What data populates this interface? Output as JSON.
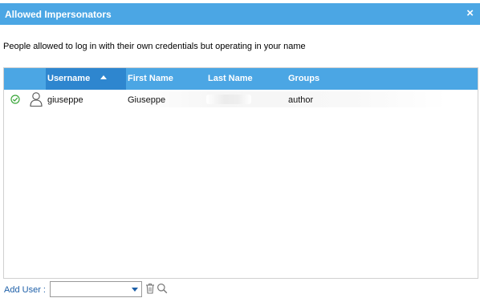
{
  "dialog": {
    "title": "Allowed Impersonators",
    "close_symbol": "×",
    "description": "People allowed to log in with their own credentials but operating in your name"
  },
  "grid": {
    "columns": [
      {
        "label": "Username",
        "sorted": "ascending"
      },
      {
        "label": "First Name"
      },
      {
        "label": "Last Name"
      },
      {
        "label": "Groups"
      }
    ],
    "rows": [
      {
        "status_icon": "check-circle-icon",
        "type_icon": "user-icon",
        "username": "giuseppe",
        "first_name": "Giuseppe",
        "last_name": "",
        "groups": "author"
      }
    ]
  },
  "footer": {
    "add_user_label": "Add User :",
    "add_user_value": "",
    "icons": [
      "trash-icon",
      "search-icon"
    ]
  },
  "colors": {
    "header_blue": "#4ba6e4",
    "sorted_column": "#2e86cf",
    "link_blue": "#1d5fa8",
    "check_green": "#3aa63a"
  }
}
